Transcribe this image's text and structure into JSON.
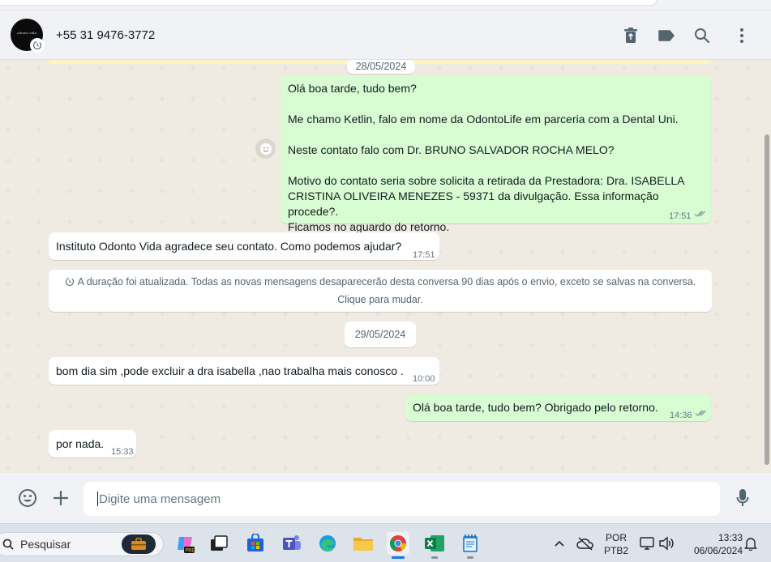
{
  "header": {
    "contact_name": "+55 31 9476-3772",
    "avatar_text": "odonto vida",
    "icons": [
      "delete-icon",
      "label-icon",
      "search-icon",
      "menu-icon"
    ]
  },
  "chat": {
    "date_1": "28/05/2024",
    "msg_out_1": {
      "lines": [
        "Olá boa tarde, tudo bem?",
        "Me chamo Ketlin, falo em nome da OdontoLife em parceria com a Dental Uni.",
        "Neste contato falo com Dr. BRUNO SALVADOR ROCHA MELO?",
        "Motivo do contato seria sobre solicita a retirada da Prestadora: Dra. ISABELLA",
        "CRISTINA OLIVEIRA MENEZES - 59371 da divulgação. Essa informação procede?.",
        "Ficamos no aguardo do retorno."
      ],
      "time": "17:51"
    },
    "msg_in_1": {
      "text": "Instituto Odonto Vida agradece seu contato. Como podemos ajudar?",
      "time": "17:51"
    },
    "system_notice": {
      "line1": "A duração foi atualizada. Todas as novas mensagens desaparecerão desta conversa 90 dias após o envio, exceto se salvas na conversa.",
      "line2": "Clique para mudar."
    },
    "date_2": "29/05/2024",
    "msg_in_2": {
      "text": "bom dia  sim ,pode excluir a dra isabella ,nao trabalha mais conosco .",
      "time": "10:00"
    },
    "msg_out_2": {
      "text": "Olá boa tarde, tudo bem? Obrigado pelo retorno.",
      "time": "14:36"
    },
    "msg_in_3": {
      "text": "por nada.",
      "time": "15:33"
    }
  },
  "composer": {
    "placeholder": "Digite uma mensagem"
  },
  "taskbar": {
    "search_label": "Pesquisar",
    "lang_line1": "POR",
    "lang_line2": "PTB2",
    "time": "13:33",
    "date": "06/06/2024"
  },
  "colors": {
    "outgoing_bubble": "#d9fdd3",
    "incoming_bubble": "#ffffff",
    "chat_background": "#efeae2",
    "read_ticks": "#8696a0"
  }
}
